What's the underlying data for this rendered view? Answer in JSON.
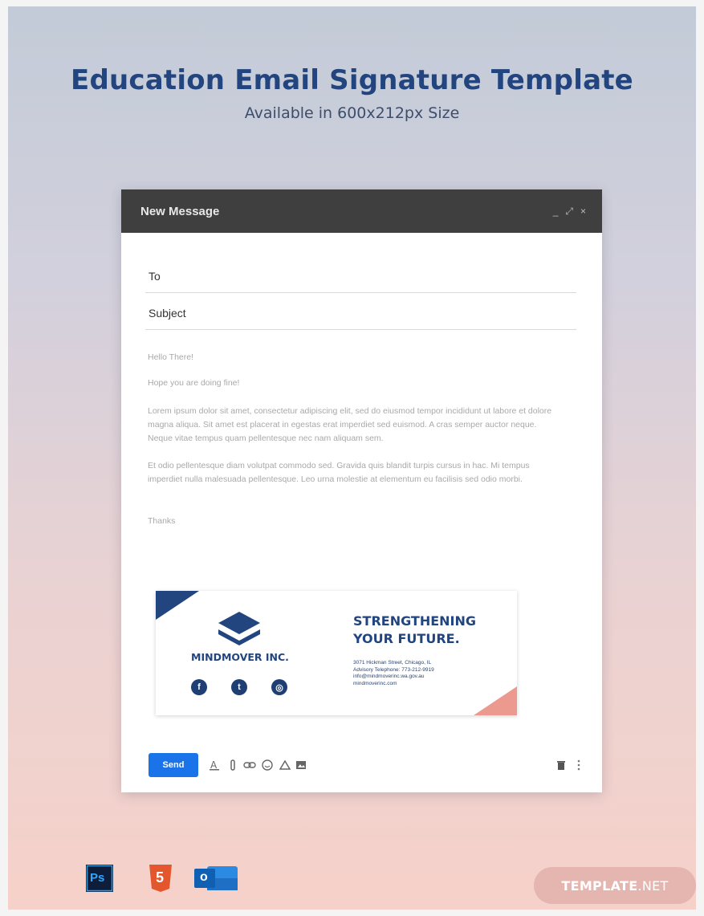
{
  "poster": {
    "title": "Education Email Signature Template",
    "subtitle": "Available in 600x212px Size"
  },
  "compose": {
    "window_title": "New Message",
    "controls": {
      "minimize": "_",
      "expand": "⤢",
      "close": "×"
    },
    "to_label": "To",
    "subject_label": "Subject",
    "body": {
      "greeting": "Hello There!",
      "line1": "Hope you are doing fine!",
      "para1": "Lorem ipsum dolor sit amet, consectetur adipiscing elit, sed do eiusmod tempor incididunt ut labore et dolore magna aliqua. Sit amet est placerat in egestas erat imperdiet sed euismod. A cras semper auctor neque. Neque vitae tempus quam pellentesque nec nam aliquam sem.",
      "para2": " Et odio pellentesque diam volutpat commodo sed. Gravida quis blandit turpis cursus in hac. Mi tempus imperdiet nulla malesuada pellentesque. Leo urna molestie at elementum eu facilisis sed odio morbi.",
      "closing": "Thanks"
    },
    "send_label": "Send"
  },
  "signature": {
    "company": "MINDMOVER INC.",
    "tagline_line1": "STRENGTHENING",
    "tagline_line2": "YOUR FUTURE.",
    "address": "3071 Hickman Street, Chicago, IL",
    "phone": "Advisory Telephone: 773-212-9919",
    "email": "info@mindmoverinc.wa.gov.au",
    "website": "mindmoverinc.com",
    "socials": [
      "f",
      "t",
      "◎"
    ]
  },
  "formats": [
    "Ps",
    "5",
    "o"
  ],
  "brand": {
    "main": "TEMPLATE",
    "suffix": ".NET"
  },
  "colors": {
    "navy": "#22457f",
    "send_blue": "#1a73e8",
    "header_dark": "#3f3f3f",
    "accent_pink": "#ec9a90"
  }
}
